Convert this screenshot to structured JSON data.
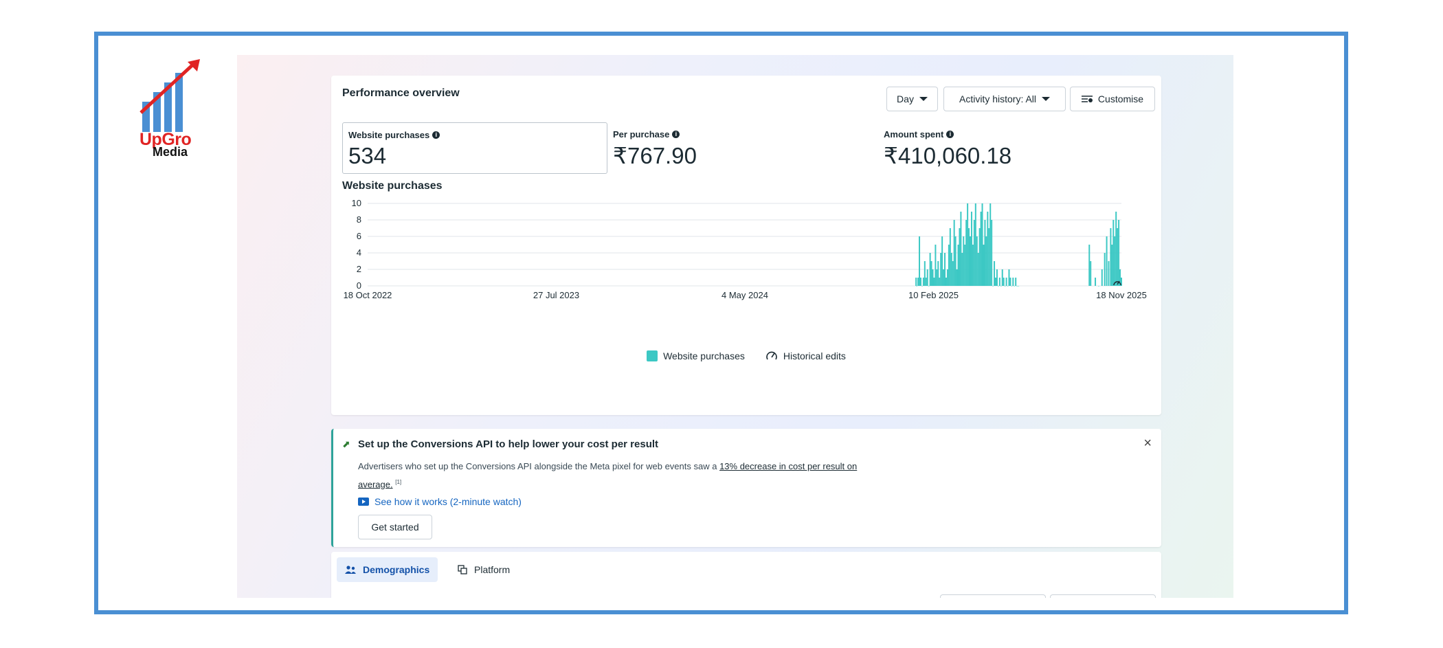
{
  "logo": {
    "line1": "UpGro",
    "line2": "Media"
  },
  "performance": {
    "title": "Performance overview",
    "buttons": {
      "day": "Day",
      "activity": "Activity history: All",
      "customise": "Customise"
    },
    "metrics": [
      {
        "label": "Website purchases",
        "value": "534"
      },
      {
        "label": "Per purchase",
        "value": "₹767.90"
      },
      {
        "label": "Amount spent",
        "value": "₹410,060.18"
      }
    ],
    "chart_title": "Website purchases"
  },
  "chart_data": {
    "type": "bar",
    "title": "Website purchases",
    "xlabel": "",
    "ylabel": "",
    "ylim": [
      0,
      10
    ],
    "yticks": [
      "0",
      "2",
      "4",
      "6",
      "8",
      "10"
    ],
    "xticks": [
      "18 Oct 2022",
      "27 Jul 2023",
      "4 May 2024",
      "10 Feb 2025",
      "18 Nov 2025"
    ],
    "x_range": [
      "2022-10-18",
      "2025-11-18"
    ],
    "legend": [
      "Website purchases",
      "Historical edits"
    ],
    "legend_position": "bottom",
    "grid": true,
    "color": "#3cc8c4",
    "x": [
      "2025-01-15",
      "2025-01-16",
      "2025-01-18",
      "2025-01-20",
      "2025-01-22",
      "2025-01-24",
      "2025-01-26",
      "2025-01-28",
      "2025-01-30",
      "2025-02-01",
      "2025-02-03",
      "2025-02-05",
      "2025-02-07",
      "2025-02-09",
      "2025-02-11",
      "2025-02-13",
      "2025-02-15",
      "2025-02-17",
      "2025-02-19",
      "2025-02-21",
      "2025-02-23",
      "2025-02-25",
      "2025-02-27",
      "2025-03-01",
      "2025-03-03",
      "2025-03-05",
      "2025-03-07",
      "2025-03-09",
      "2025-03-11",
      "2025-03-13",
      "2025-03-15",
      "2025-03-17",
      "2025-03-19",
      "2025-03-21",
      "2025-03-23",
      "2025-03-25",
      "2025-03-27",
      "2025-03-29",
      "2025-03-31",
      "2025-04-02",
      "2025-04-04",
      "2025-04-06",
      "2025-04-08",
      "2025-04-10",
      "2025-04-12",
      "2025-04-14",
      "2025-04-16",
      "2025-04-18",
      "2025-04-20",
      "2025-04-22",
      "2025-04-24",
      "2025-04-26",
      "2025-04-28",
      "2025-04-30",
      "2025-05-02",
      "2025-05-04",
      "2025-05-06",
      "2025-05-08",
      "2025-05-10",
      "2025-05-12",
      "2025-05-14",
      "2025-05-16",
      "2025-05-18",
      "2025-05-20",
      "2025-05-22",
      "2025-05-24",
      "2025-05-26",
      "2025-05-28",
      "2025-05-30",
      "2025-06-01",
      "2025-06-03",
      "2025-06-05",
      "2025-06-07",
      "2025-06-09",
      "2025-06-11",
      "2025-06-13",
      "2025-06-15",
      "2025-06-17",
      "2025-10-01",
      "2025-10-03",
      "2025-10-10",
      "2025-10-15",
      "2025-10-20",
      "2025-10-24",
      "2025-10-27",
      "2025-10-30",
      "2025-11-02",
      "2025-11-04",
      "2025-11-06",
      "2025-11-08",
      "2025-11-10",
      "2025-11-12",
      "2025-11-14",
      "2025-11-16",
      "2025-11-18"
    ],
    "values": [
      1,
      0,
      1,
      6,
      1,
      0,
      1,
      3,
      1,
      2,
      0,
      4,
      3,
      2,
      1,
      5,
      2,
      3,
      1,
      4,
      6,
      2,
      4,
      1,
      2,
      5,
      7,
      4,
      3,
      8,
      6,
      2,
      5,
      7,
      9,
      4,
      6,
      5,
      8,
      10,
      7,
      6,
      9,
      5,
      8,
      10,
      6,
      4,
      7,
      9,
      10,
      5,
      8,
      6,
      9,
      7,
      10,
      8,
      0,
      3,
      1,
      2,
      0,
      1,
      0,
      2,
      1,
      0,
      1,
      0,
      2,
      1,
      0,
      1,
      0,
      1,
      0,
      0,
      5,
      3,
      1,
      0,
      2,
      4,
      6,
      3,
      7,
      5,
      8,
      6,
      9,
      7,
      8,
      2,
      1
    ]
  },
  "capi": {
    "title": "Set up the Conversions API to help lower your cost per result",
    "text_before": "Advertisers who set up the Conversions API alongside the Meta pixel for web events saw a ",
    "text_link": "13% decrease in cost per result on average.",
    "footnote": "[1]",
    "watch_link": "See how it works (2-minute watch)",
    "cta": "Get started",
    "close": "×"
  },
  "tabs": [
    {
      "label": "Demographics"
    },
    {
      "label": "Platform"
    }
  ]
}
